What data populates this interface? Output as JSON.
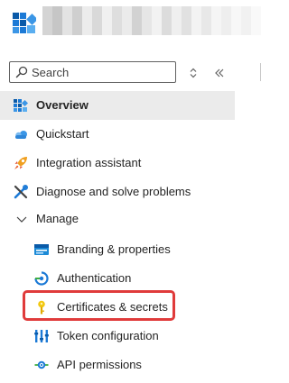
{
  "header": {
    "logo_icon": "app-registration-grid-icon",
    "title_obscured": true
  },
  "search": {
    "placeholder": "Search",
    "value": ""
  },
  "toolbar": {
    "expand_collapse_icon": "chevron-up-down-icon",
    "collapse_menu_icon": "double-chevron-left-icon"
  },
  "nav": {
    "items": [
      {
        "label": "Overview",
        "icon": "overview-grid-icon",
        "selected": true
      },
      {
        "label": "Quickstart",
        "icon": "cloud-icon"
      },
      {
        "label": "Integration assistant",
        "icon": "rocket-icon"
      },
      {
        "label": "Diagnose and solve problems",
        "icon": "wrench-icon"
      }
    ],
    "manage": {
      "label": "Manage",
      "expanded": true,
      "items": [
        {
          "label": "Branding & properties",
          "icon": "branding-card-icon"
        },
        {
          "label": "Authentication",
          "icon": "authentication-icon"
        },
        {
          "label": "Certificates & secrets",
          "icon": "key-icon",
          "highlighted": true
        },
        {
          "label": "Token configuration",
          "icon": "token-bars-icon"
        },
        {
          "label": "API permissions",
          "icon": "api-permissions-icon"
        }
      ]
    }
  },
  "colors": {
    "selected_bg": "#ebebeb",
    "highlight_border": "#e03b3b",
    "brand_blue": "#0078d4"
  }
}
